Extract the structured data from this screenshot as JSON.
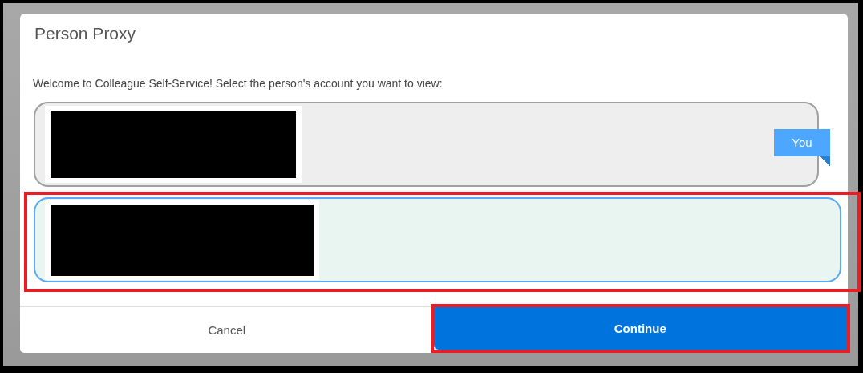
{
  "dialog": {
    "title": "Person Proxy",
    "prompt": "Welcome to Colleague Self-Service! Select the person's account you want to view:"
  },
  "accounts": [
    {
      "redacted": true,
      "badge": "You",
      "selected": false,
      "highlighted": false
    },
    {
      "redacted": true,
      "selected": true,
      "highlighted": true
    }
  ],
  "buttons": [
    {
      "label": "Cancel",
      "kind": "secondary",
      "highlighted": false
    },
    {
      "label": "Continue",
      "kind": "primary",
      "highlighted": true
    }
  ]
}
